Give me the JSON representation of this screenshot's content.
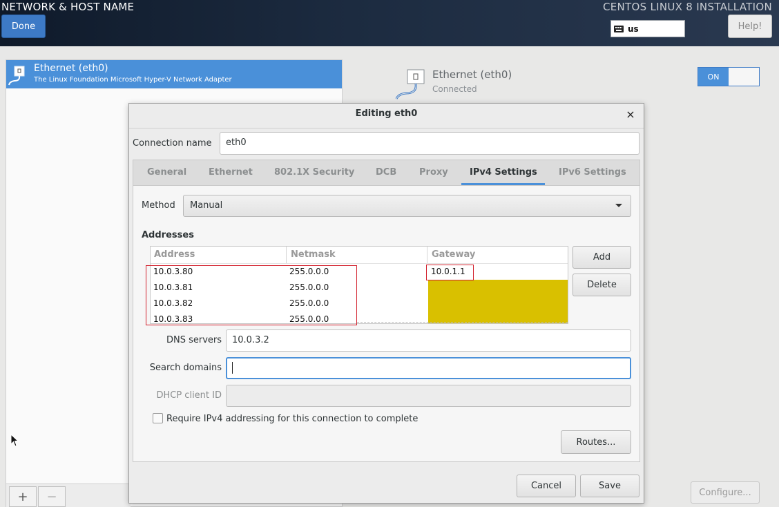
{
  "header": {
    "title": "NETWORK & HOST NAME",
    "product": "CENTOS LINUX 8 INSTALLATION",
    "done_label": "Done",
    "keyboard_layout": "us",
    "help_label": "Help!"
  },
  "device_list": {
    "items": [
      {
        "name": "Ethernet (eth0)",
        "description": "The Linux Foundation Microsoft Hyper-V Network Adapter"
      }
    ],
    "add_label": "+",
    "remove_label": "−"
  },
  "device_detail": {
    "name": "Ethernet (eth0)",
    "status": "Connected",
    "toggle_label": "ON",
    "configure_label": "Configure..."
  },
  "dialog": {
    "title": "Editing eth0",
    "close_label": "×",
    "connection_name_label": "Connection name",
    "connection_name_value": "eth0",
    "tabs": [
      {
        "label": "General"
      },
      {
        "label": "Ethernet"
      },
      {
        "label": "802.1X Security"
      },
      {
        "label": "DCB"
      },
      {
        "label": "Proxy"
      },
      {
        "label": "IPv4 Settings"
      },
      {
        "label": "IPv6 Settings"
      }
    ],
    "active_tab": "IPv4 Settings",
    "method_label": "Method",
    "method_value": "Manual",
    "addresses_heading": "Addresses",
    "address_columns": [
      "Address",
      "Netmask",
      "Gateway"
    ],
    "addresses": [
      {
        "address": "10.0.3.80",
        "netmask": "255.0.0.0",
        "gateway": "10.0.1.1"
      },
      {
        "address": "10.0.3.81",
        "netmask": "255.0.0.0",
        "gateway": ""
      },
      {
        "address": "10.0.3.82",
        "netmask": "255.0.0.0",
        "gateway": ""
      },
      {
        "address": "10.0.3.83",
        "netmask": "255.0.0.0",
        "gateway": ""
      }
    ],
    "add_label": "Add",
    "delete_label": "Delete",
    "dns_label": "DNS servers",
    "dns_value": "10.0.3.2",
    "search_domains_label": "Search domains",
    "search_domains_value": "",
    "dhcp_label": "DHCP client ID",
    "dhcp_value": "",
    "require_ipv4_label": "Require IPv4 addressing for this connection to complete",
    "require_ipv4_checked": false,
    "routes_label": "Routes...",
    "cancel_label": "Cancel",
    "save_label": "Save"
  },
  "colors": {
    "accent": "#4a90d9",
    "highlight_red": "#d21f2b",
    "highlight_yellow": "#d9c000"
  }
}
